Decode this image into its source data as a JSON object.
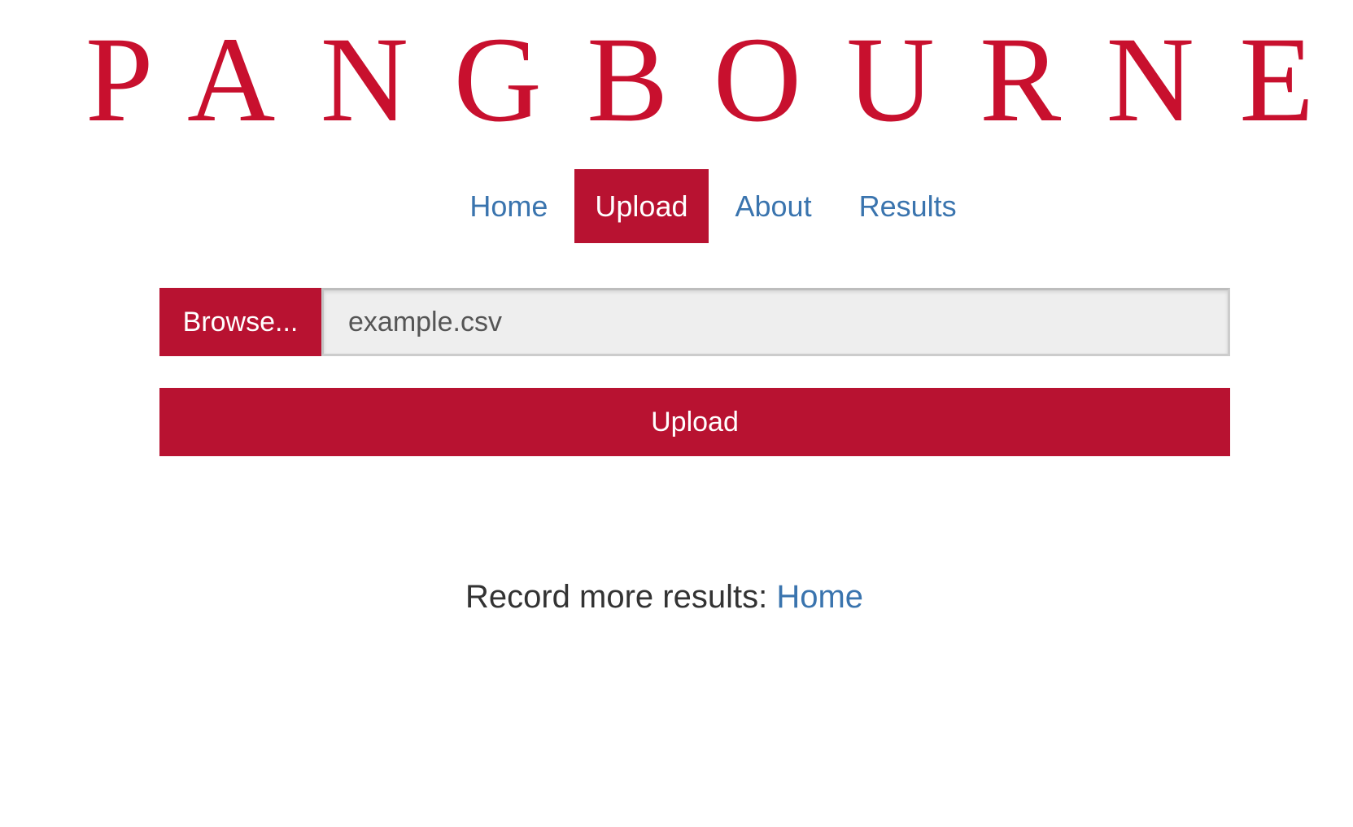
{
  "logo": {
    "text": "PANGBOURNE",
    "color": "#c8102e"
  },
  "nav": {
    "items": [
      {
        "label": "Home",
        "active": false
      },
      {
        "label": "Upload",
        "active": true
      },
      {
        "label": "About",
        "active": false
      },
      {
        "label": "Results",
        "active": false
      }
    ]
  },
  "upload_form": {
    "browse_label": "Browse...",
    "file_name": "example.csv",
    "submit_label": "Upload"
  },
  "footer": {
    "text": "Record more results: ",
    "link_label": "Home"
  },
  "colors": {
    "accent": "#b81231",
    "link": "#3a74ae",
    "field_background": "#eeeeee"
  },
  "icons": []
}
